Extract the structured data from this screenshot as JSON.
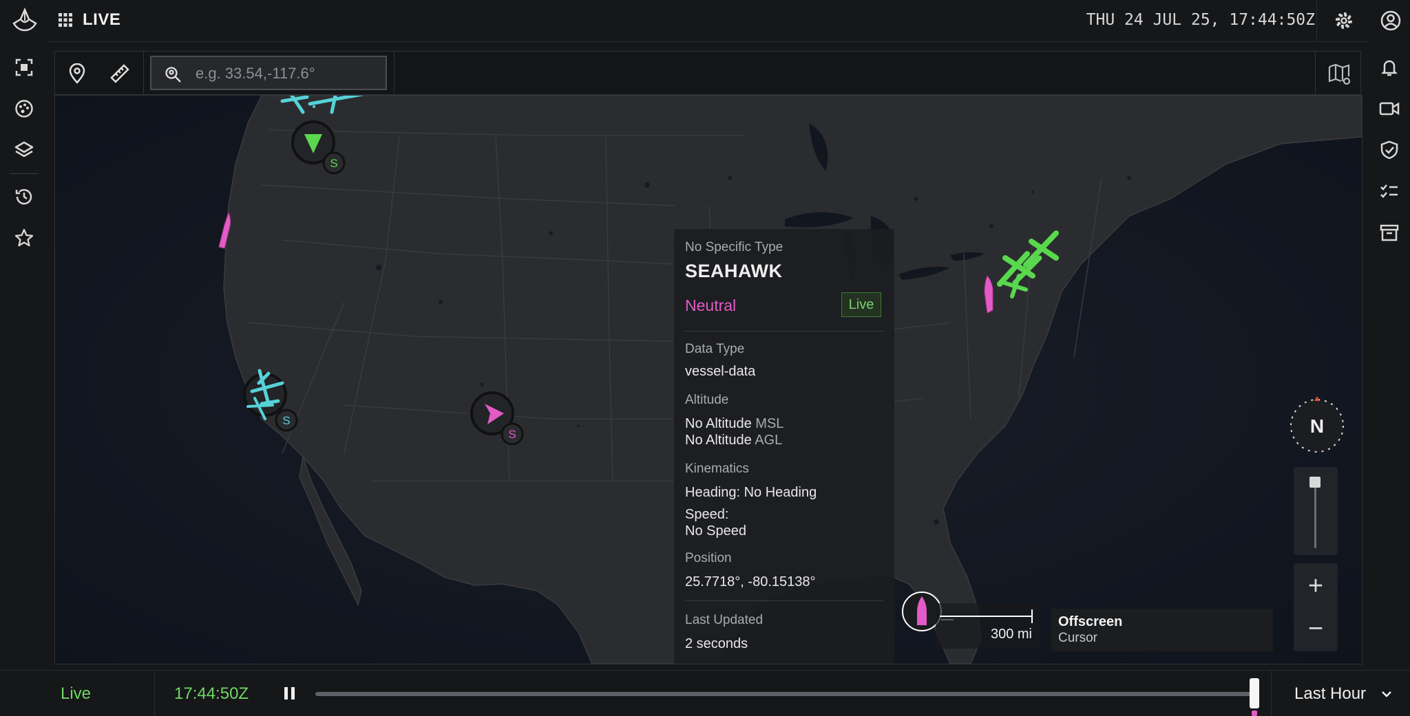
{
  "topbar": {
    "app_title": "LIVE",
    "clock": "THU 24 JUL 25, 17:44:50Z",
    "icons": [
      "logo-icon",
      "apps-grid-icon",
      "gear-icon",
      "user-icon"
    ]
  },
  "leftbar": {
    "items": [
      "focus-icon",
      "palette-icon",
      "layers-icon",
      "history-icon",
      "star-icon"
    ]
  },
  "rightbar": {
    "items": [
      "bell-icon",
      "video-icon",
      "shield-check-icon",
      "tasks-icon",
      "archive-icon"
    ]
  },
  "toolbar": {
    "search_placeholder": "e.g. 33.54,-117.6°",
    "search_value": "",
    "icons": [
      "location-pin-icon",
      "ruler-icon",
      "search-location-icon",
      "map-settings-icon"
    ]
  },
  "popup": {
    "type": "No Specific Type",
    "name": "SEAHAWK",
    "affiliation": "Neutral",
    "status": "Live",
    "data_type_label": "Data Type",
    "data_type_value": "vessel-data",
    "altitude_label": "Altitude",
    "altitude_msl_value": "No Altitude",
    "altitude_msl_unit": "MSL",
    "altitude_agl_value": "No Altitude",
    "altitude_agl_unit": "AGL",
    "kinematics_label": "Kinematics",
    "heading": "Heading: No Heading",
    "speed_label": "Speed:",
    "speed_value": "No Speed",
    "position_label": "Position",
    "position_value": "25.7718°, -80.15138°",
    "last_updated_label": "Last Updated",
    "last_updated_value": "2 seconds"
  },
  "map": {
    "scale_label": "300 mi",
    "cursor_title": "Offscreen",
    "cursor_subtitle": "Cursor",
    "compass_label": "N",
    "zoom_in": "+",
    "zoom_out": "−",
    "cluster_badge": "S",
    "colors": {
      "friendly": "#59d84e",
      "neutral": "#e35bc6",
      "unknown": "#56d2d8"
    }
  },
  "timeline": {
    "mode": "Live",
    "time": "17:44:50Z",
    "range": "Last Hour",
    "position_fraction": 1.0
  }
}
